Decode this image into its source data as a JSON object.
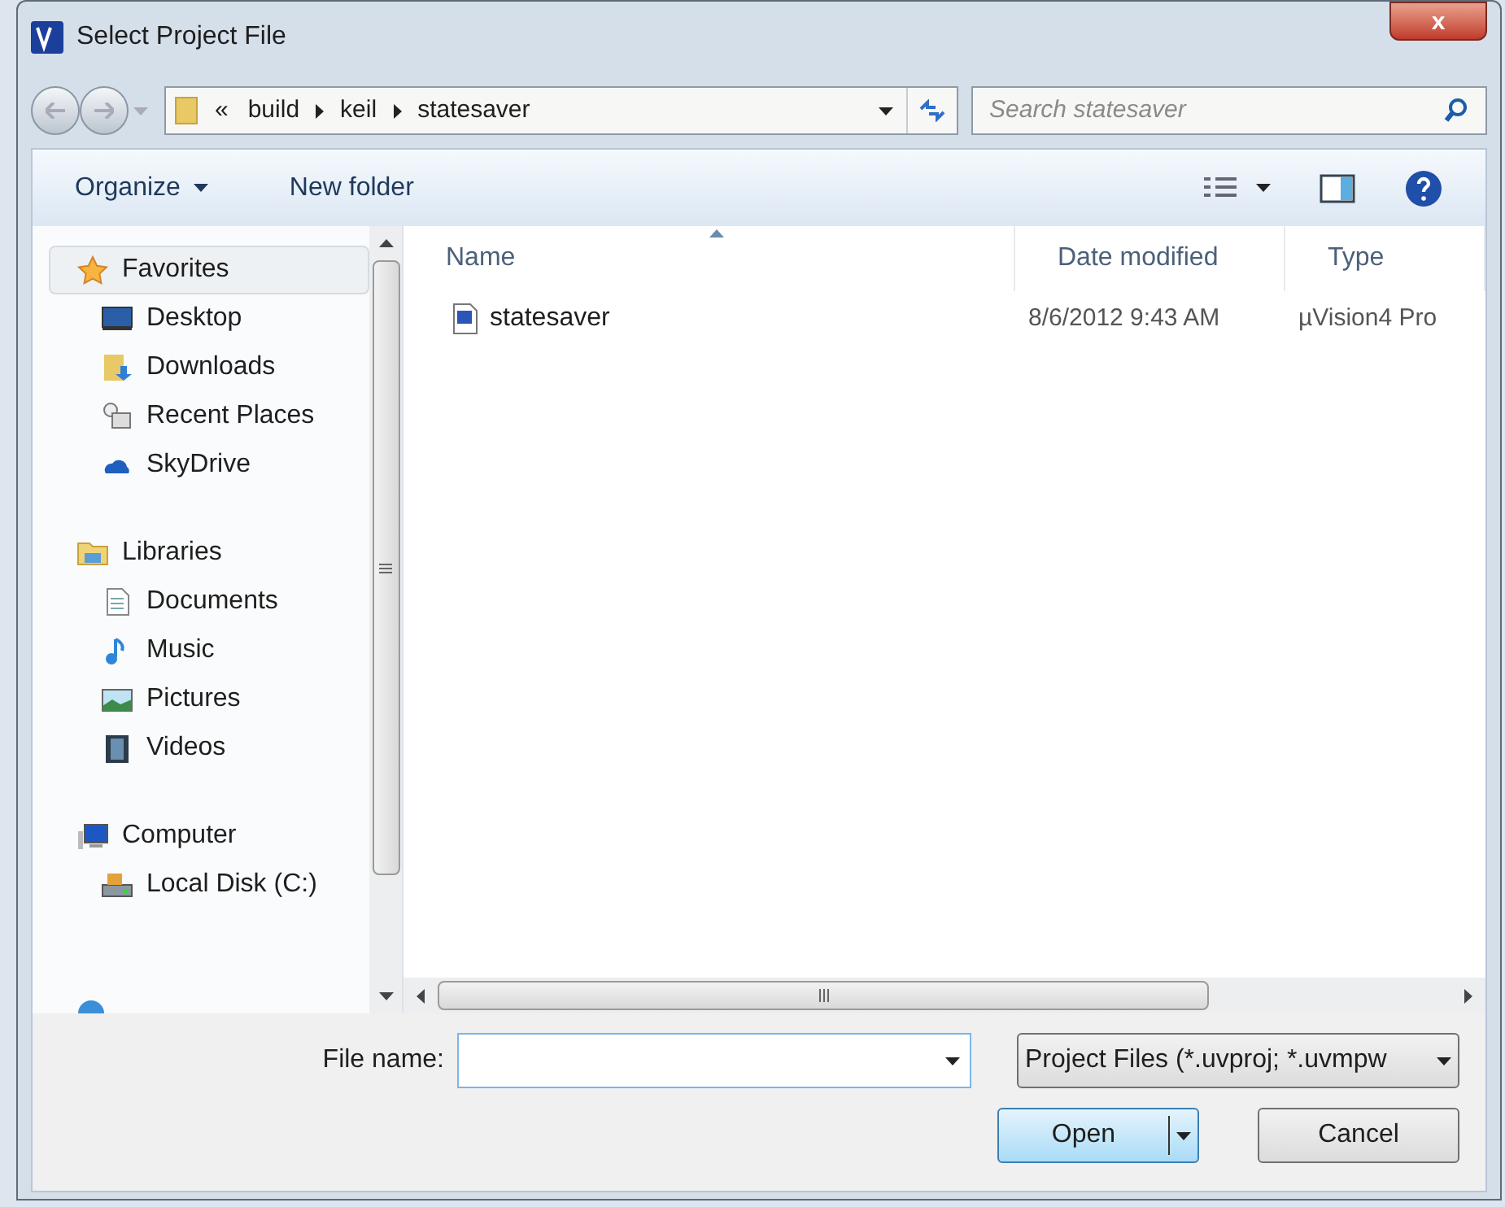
{
  "window": {
    "title": "Select Project File",
    "close_glyph": "x"
  },
  "address_bar": {
    "overflow": "«",
    "path": [
      "build",
      "keil",
      "statesaver"
    ]
  },
  "search": {
    "placeholder": "Search statesaver"
  },
  "toolbar": {
    "buttons": [
      {
        "label": "Organize",
        "has_menu": true
      },
      {
        "label": "New folder",
        "has_menu": false
      }
    ]
  },
  "nav": [
    {
      "label": "Favorites",
      "kind": "star",
      "selected": true,
      "children": [
        {
          "label": "Desktop",
          "kind": "desktop",
          "selected": false
        },
        {
          "label": "Downloads",
          "kind": "downloads",
          "selected": false
        },
        {
          "label": "Recent Places",
          "kind": "recent",
          "selected": false
        },
        {
          "label": "SkyDrive",
          "kind": "cloud",
          "selected": false
        }
      ]
    },
    {
      "label": "Libraries",
      "kind": "library",
      "selected": false,
      "children": [
        {
          "label": "Documents",
          "kind": "document",
          "selected": false
        },
        {
          "label": "Music",
          "kind": "music",
          "selected": false
        },
        {
          "label": "Pictures",
          "kind": "picture",
          "selected": false
        },
        {
          "label": "Videos",
          "kind": "video",
          "selected": false
        }
      ]
    },
    {
      "label": "Computer",
      "kind": "computer",
      "selected": false,
      "children": [
        {
          "label": "Local Disk (C:)",
          "kind": "disk",
          "selected": false
        }
      ]
    }
  ],
  "table": {
    "columns": [
      {
        "label": "Name",
        "sorted": true
      },
      {
        "label": "Date modified",
        "sorted": false
      },
      {
        "label": "Type",
        "sorted": false
      }
    ],
    "rows": [
      {
        "name": "statesaver",
        "date": "8/6/2012 9:43 AM",
        "type": "µVision4 Pro",
        "selected": false
      }
    ]
  },
  "file_name": {
    "label": "File name:"
  },
  "file_type": {
    "value": "Project Files (*.uvproj; *.uvmpw"
  },
  "buttons": [
    {
      "label": "Open",
      "kind": "split"
    },
    {
      "label": "Cancel",
      "kind": "plain"
    }
  ]
}
